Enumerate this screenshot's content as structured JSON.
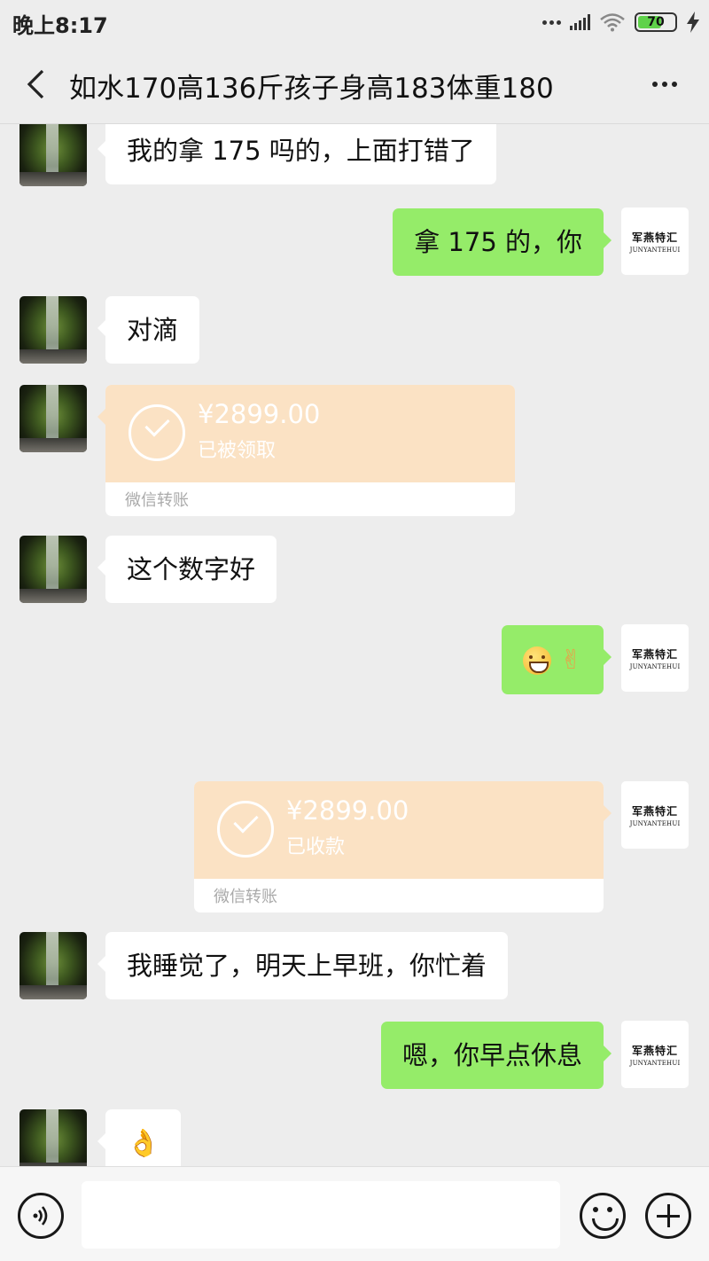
{
  "status_bar": {
    "time": "晚上8:17",
    "battery_level": "70",
    "icons": [
      "more-dots-icon",
      "signal-icon",
      "wifi-icon",
      "battery-icon",
      "charging-icon"
    ]
  },
  "nav": {
    "title": "如水170高136斤孩子身高183体重180",
    "back_icon": "chevron-left-icon",
    "more_icon": "more-horizontal-icon"
  },
  "messages": [
    {
      "side": "left",
      "type": "text",
      "text": "我的拿 175 吗的，上面打错了"
    },
    {
      "side": "right",
      "type": "text",
      "text": "拿 175 的，你"
    },
    {
      "side": "left",
      "type": "text",
      "text": "对滴"
    },
    {
      "side": "left",
      "type": "transfer",
      "amount": "¥2899.00",
      "status": "已被领取",
      "footer": "微信转账"
    },
    {
      "side": "left",
      "type": "text",
      "text": "这个数字好"
    },
    {
      "side": "right",
      "type": "emoji",
      "emojis": [
        "grin-emoji",
        "hand-emoji"
      ]
    },
    {
      "side": "right",
      "type": "transfer",
      "amount": "¥2899.00",
      "status": "已收款",
      "footer": "微信转账"
    },
    {
      "side": "left",
      "type": "text",
      "text": "我睡觉了，明天上早班，你忙着"
    },
    {
      "side": "right",
      "type": "text",
      "text": "嗯，你早点休息"
    },
    {
      "side": "left",
      "type": "emoji",
      "emojis": [
        "ok-hand-emoji"
      ]
    }
  ],
  "my_avatar": {
    "logo_cn": "军燕特汇",
    "logo_en": "JUNYANTEHUI"
  },
  "input_bar": {
    "icons": [
      "voice-icon",
      "emoji-icon",
      "plus-icon"
    ]
  },
  "colors": {
    "background": "#ededed",
    "outgoing_bubble": "#95ec69",
    "incoming_bubble": "#ffffff",
    "transfer_card": "#fbe2c4"
  }
}
